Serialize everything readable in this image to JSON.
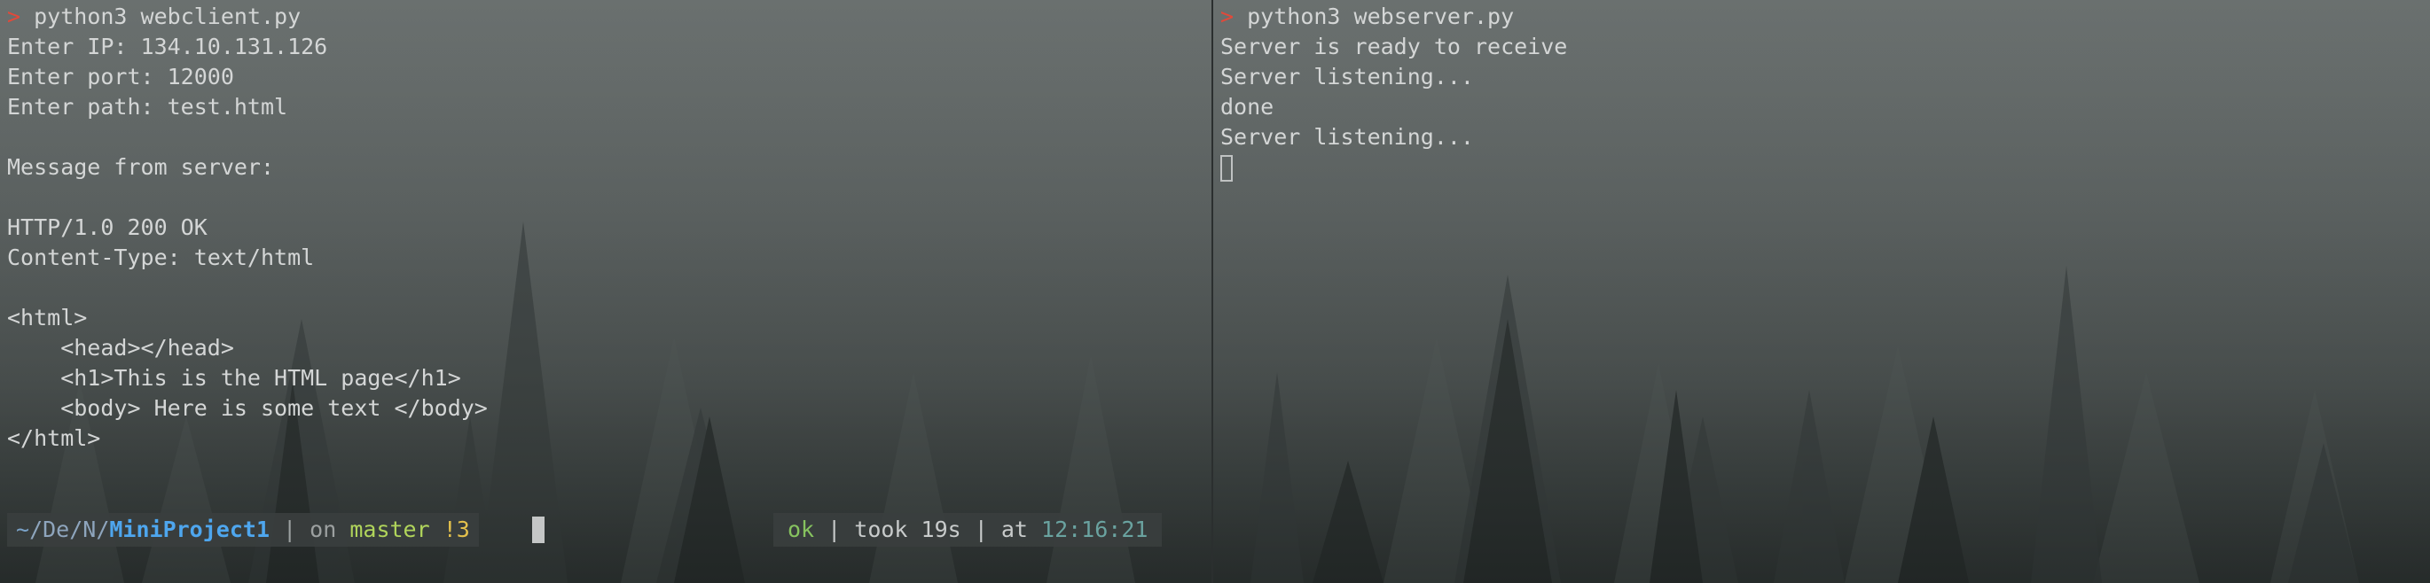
{
  "left_pane": {
    "command": "python3 webclient.py",
    "prompt_symbol": ">",
    "output": [
      "Enter IP: 134.10.131.126",
      "Enter port: 12000",
      "Enter path: test.html",
      "",
      "Message from server:",
      "",
      "HTTP/1.0 200 OK",
      "Content-Type: text/html",
      "",
      "<html>",
      "    <head></head>",
      "    <h1>This is the HTML page</h1>",
      "    <body> Here is some text </body>",
      "</html>"
    ],
    "status": {
      "path_prefix": "~",
      "path_mid": "/De/N/",
      "dir": "MiniProject1",
      "on_text": "| on",
      "branch": "master",
      "dirty": "!3",
      "result": "ok",
      "took_text": "| took 19s | at",
      "time": "12:16:21"
    }
  },
  "right_pane": {
    "command": "python3 webserver.py",
    "prompt_symbol": ">",
    "output": [
      "Server is ready to receive",
      "Server listening...",
      "done",
      "Server listening..."
    ]
  },
  "colors": {
    "prompt_arrow": "#e2493a",
    "text": "#d4d6d6",
    "directory": "#4ea6ee",
    "branch": "#b0d45b",
    "dirty": "#e3c04c",
    "ok": "#86c25f",
    "time": "#6aa3a0"
  }
}
